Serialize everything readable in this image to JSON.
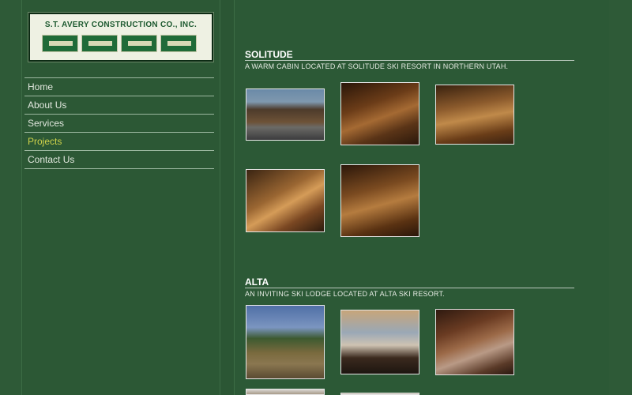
{
  "company": {
    "logo_text": "S.T. AVERY CONSTRUCTION CO., INC."
  },
  "nav": {
    "items": [
      {
        "label": "Home",
        "active": false
      },
      {
        "label": "About Us",
        "active": false
      },
      {
        "label": "Services",
        "active": false
      },
      {
        "label": "Projects",
        "active": true
      },
      {
        "label": "Contact Us",
        "active": false
      }
    ]
  },
  "sections": [
    {
      "title": "SOLITUDE",
      "description": "A WARM CABIN LOCATED AT SOLITUDE SKI RESORT IN NORTHERN UTAH.",
      "photos": [
        "exterior",
        "interior",
        "interior",
        "interior",
        "interior"
      ]
    },
    {
      "title": "ALTA",
      "description": "AN INVITING SKI LODGE LOCATED AT ALTA SKI RESORT.",
      "photos": [
        "exterior",
        "interior",
        "interior",
        "interior",
        "interior"
      ]
    }
  ],
  "colors": {
    "background": "#2b5634",
    "nav_active": "#cfd24a",
    "logo_green": "#1f6b38"
  }
}
